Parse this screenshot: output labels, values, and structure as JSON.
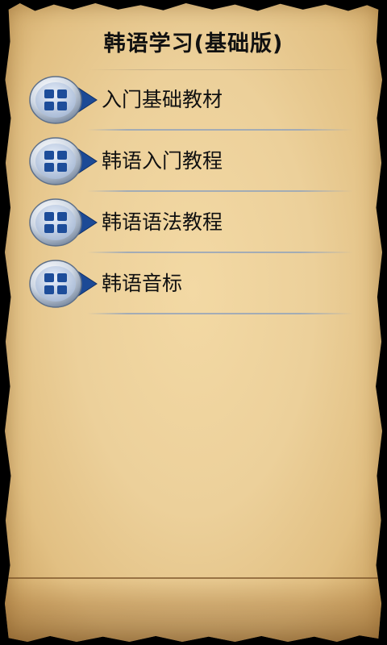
{
  "app": {
    "title": "韩语学习(基础版)"
  },
  "menu": {
    "items": [
      {
        "label": "入门基础教材",
        "icon": "grid-arrow-icon"
      },
      {
        "label": "韩语入门教程",
        "icon": "grid-arrow-icon"
      },
      {
        "label": "韩语语法教程",
        "icon": "grid-arrow-icon"
      },
      {
        "label": "韩语音标",
        "icon": "grid-arrow-icon"
      }
    ]
  },
  "colors": {
    "parchment": "#ecd09a",
    "background": "#000000",
    "icon_blue": "#1f4f9a",
    "icon_ring": "#dfe6f0"
  }
}
